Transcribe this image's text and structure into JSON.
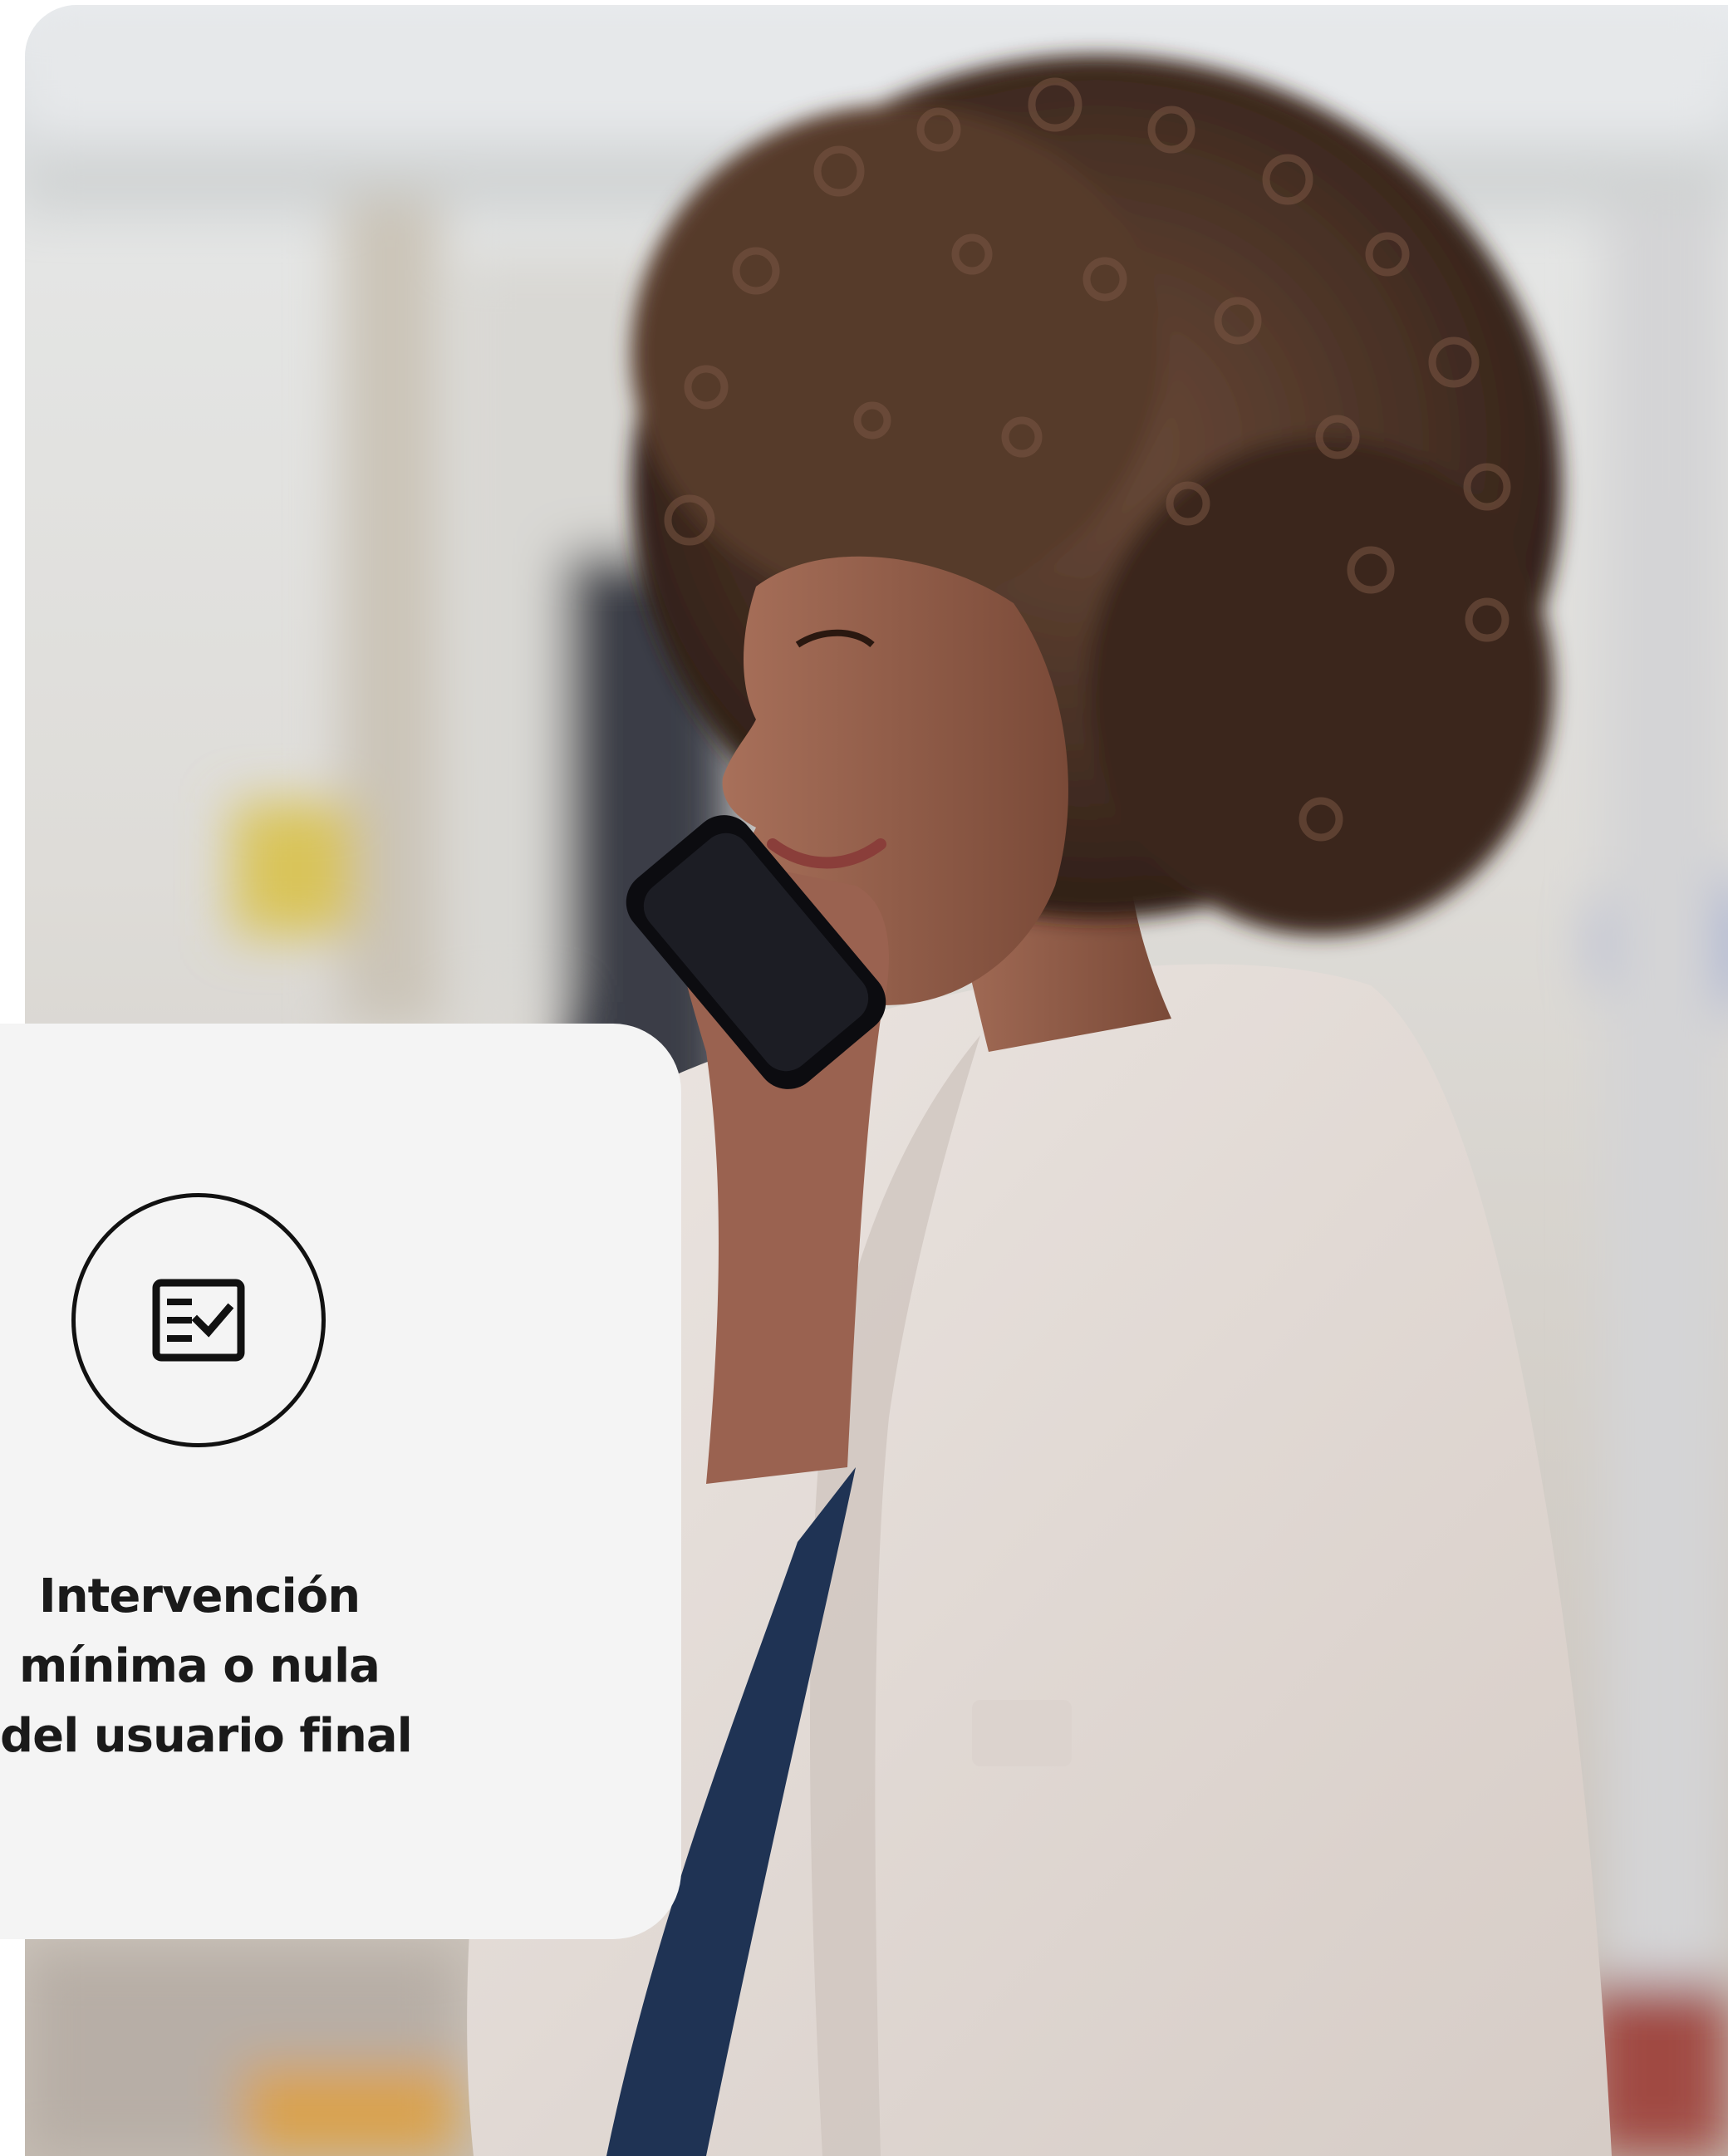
{
  "feature": {
    "icon": "checklist-icon",
    "title_lines": [
      "Intervención",
      "mínima o nula",
      "del usuario final"
    ]
  },
  "colors": {
    "card_background": "#f4f4f4",
    "text": "#1a1a1a",
    "icon_stroke": "#111111",
    "page_background": "#ffffff"
  }
}
